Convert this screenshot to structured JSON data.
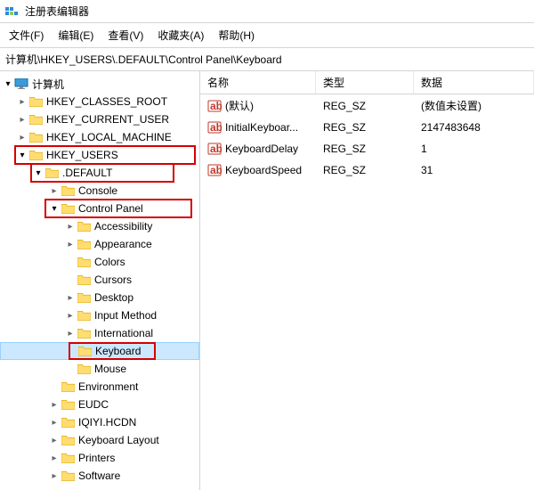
{
  "window": {
    "title": "注册表编辑器"
  },
  "menu": {
    "file": "文件(F)",
    "edit": "编辑(E)",
    "view": "查看(V)",
    "favorites": "收藏夹(A)",
    "help": "帮助(H)"
  },
  "address": "计算机\\HKEY_USERS\\.DEFAULT\\Control Panel\\Keyboard",
  "tree": {
    "root": "计算机",
    "hkcr": "HKEY_CLASSES_ROOT",
    "hkcu": "HKEY_CURRENT_USER",
    "hklm": "HKEY_LOCAL_MACHINE",
    "hku": "HKEY_USERS",
    "default": ".DEFAULT",
    "console": "Console",
    "controlpanel": "Control Panel",
    "accessibility": "Accessibility",
    "appearance": "Appearance",
    "colors": "Colors",
    "cursors": "Cursors",
    "desktop": "Desktop",
    "inputmethod": "Input Method",
    "international": "International",
    "keyboard": "Keyboard",
    "mouse": "Mouse",
    "environment": "Environment",
    "eudc": "EUDC",
    "iqiyi": "IQIYI.HCDN",
    "keyboardlayout": "Keyboard Layout",
    "printers": "Printers",
    "software": "Software"
  },
  "list": {
    "headers": {
      "name": "名称",
      "type": "类型",
      "data": "数据"
    },
    "rows": [
      {
        "name": "(默认)",
        "type": "REG_SZ",
        "data": "(数值未设置)"
      },
      {
        "name": "InitialKeyboar...",
        "type": "REG_SZ",
        "data": "2147483648"
      },
      {
        "name": "KeyboardDelay",
        "type": "REG_SZ",
        "data": "1"
      },
      {
        "name": "KeyboardSpeed",
        "type": "REG_SZ",
        "data": "31"
      }
    ]
  }
}
